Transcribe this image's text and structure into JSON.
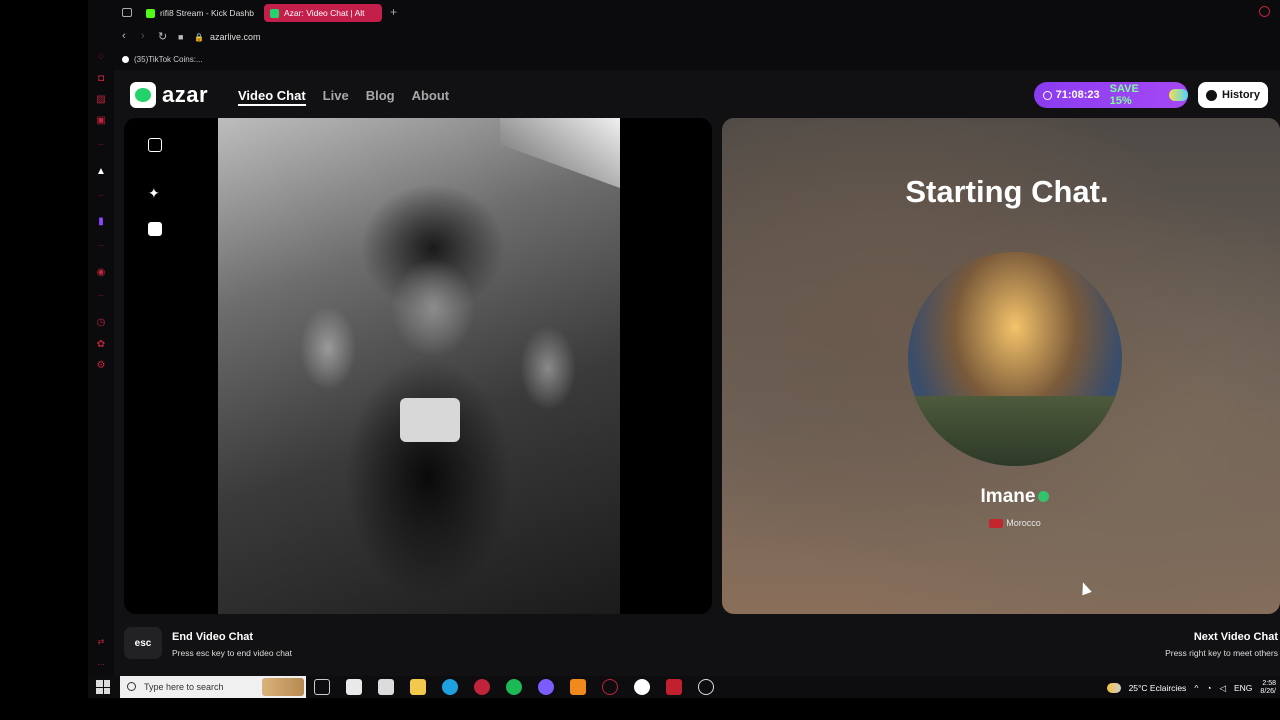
{
  "browser": {
    "tabs": [
      {
        "label": "rifi8 Stream - Kick Dashb",
        "favicon_color": "#53fc18",
        "active": false
      },
      {
        "label": "Azar: Video Chat | Alt",
        "favicon_color": "#22d26b",
        "active": true
      }
    ],
    "url": "azarlive.com",
    "bookmark": "(35)TikTok Coins:..."
  },
  "site": {
    "logo_text": "azar",
    "nav": [
      "Video Chat",
      "Live",
      "Blog",
      "About"
    ],
    "promo": {
      "timer": "71:08:23",
      "save": "SAVE 15%"
    },
    "history_label": "History"
  },
  "chat": {
    "status_title": "Starting Chat.",
    "partner_name": "Imane",
    "partner_country": "Morocco"
  },
  "footer": {
    "esc_key": "esc",
    "end_title": "End Video Chat",
    "end_sub": "Press esc key to end video chat",
    "next_title": "Next Video Chat",
    "next_sub": "Press right key to meet others"
  },
  "taskbar": {
    "search_placeholder": "Type here to search",
    "weather": "25°C Eclaircies",
    "lang": "ENG",
    "time": "2:58",
    "date": "8/26/"
  },
  "colors": {
    "accent_brand": "#22d26b",
    "opera_red": "#c0243a",
    "active_tab": "#c41e4a",
    "promo_purple": "#8a3cf0"
  }
}
